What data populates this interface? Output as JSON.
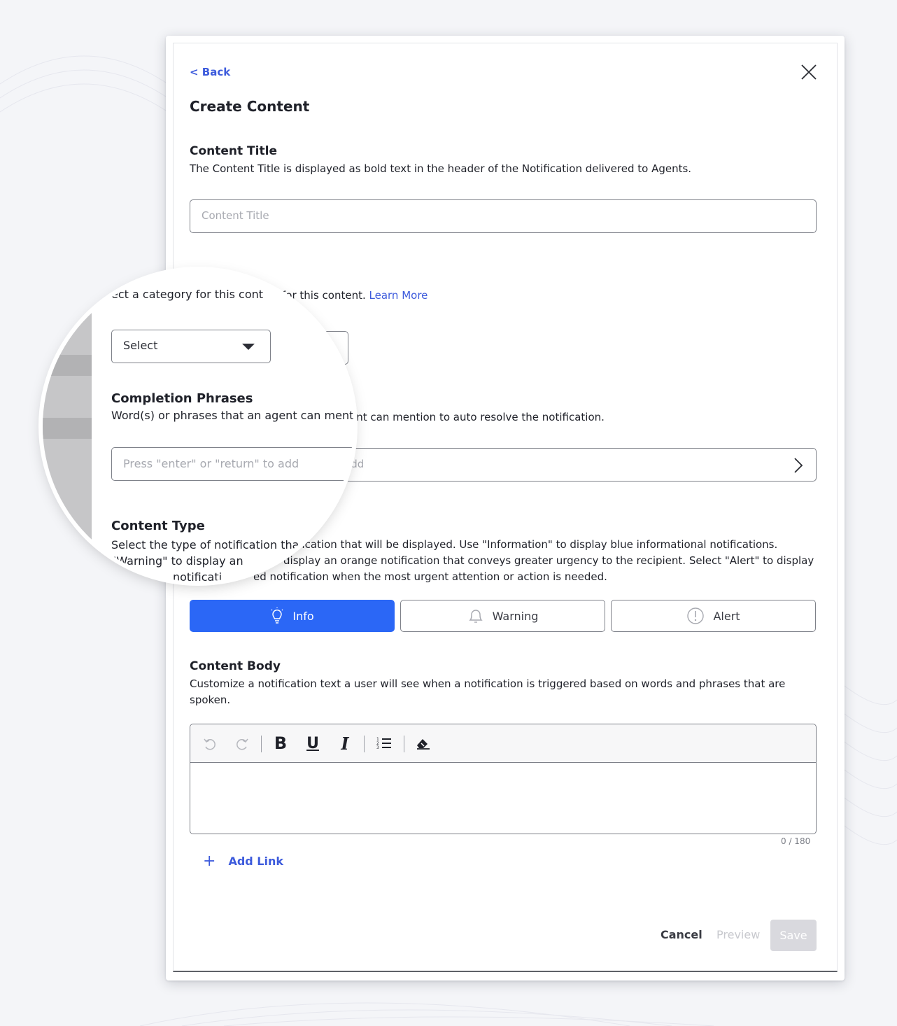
{
  "header": {
    "back_label": "< Back",
    "title": "Create Content"
  },
  "content_title": {
    "label": "Content Title",
    "description": "The Content Title is displayed as bold text in the header of the Notification delivered to Agents.",
    "placeholder": "Content Title"
  },
  "category": {
    "description": "for this content.",
    "learn_more": "Learn More",
    "select_label": "Select",
    "magnified_description": "ect a category for this cont"
  },
  "completion_phrases": {
    "label": "Completion Phrases",
    "description_tail": "ent can mention to auto resolve the notification.",
    "magnified_description": "Word(s) or phrases that an agent can menti",
    "placeholder_tail": "add",
    "magnified_placeholder": "Press \"enter\" or \"return\" to add"
  },
  "content_type": {
    "label": "Content Type",
    "line1_tail": "ification that will be displayed. Use \"Information\" to display blue informational notifications.",
    "line2_tail": "display an orange notification that conveys greater urgency to the recipient. Select \"Alert\" to display",
    "line3_tail": "ed notification when the most urgent attention or action is needed.",
    "magnified_line1": "Select the type of notification tha",
    "magnified_line2": "\"Warning\" to display an",
    "magnified_line3": "notificati",
    "options": [
      {
        "label": "Info",
        "icon": "lightbulb-icon",
        "selected": true
      },
      {
        "label": "Warning",
        "icon": "bell-icon",
        "selected": false
      },
      {
        "label": "Alert",
        "icon": "exclamation-circle-icon",
        "selected": false
      }
    ]
  },
  "content_body": {
    "label": "Content Body",
    "description_line1": "Customize a notification text a user will see when a notification is triggered based on words and phrases that are",
    "description_line2": "spoken.",
    "toolbar": [
      "undo-icon",
      "redo-icon",
      "bold-icon",
      "underline-icon",
      "italic-icon",
      "ordered-list-icon",
      "eraser-icon"
    ],
    "bold_glyph": "B",
    "underline_glyph": "U",
    "italic_glyph": "I",
    "counter": "0 / 180"
  },
  "add_link": {
    "plus": "+",
    "label": "Add Link"
  },
  "footer": {
    "cancel": "Cancel",
    "preview": "Preview",
    "save": "Save"
  },
  "colors": {
    "accent": "#2b67f6",
    "link": "#3d5bdc",
    "disabled": "#d9d9de"
  }
}
